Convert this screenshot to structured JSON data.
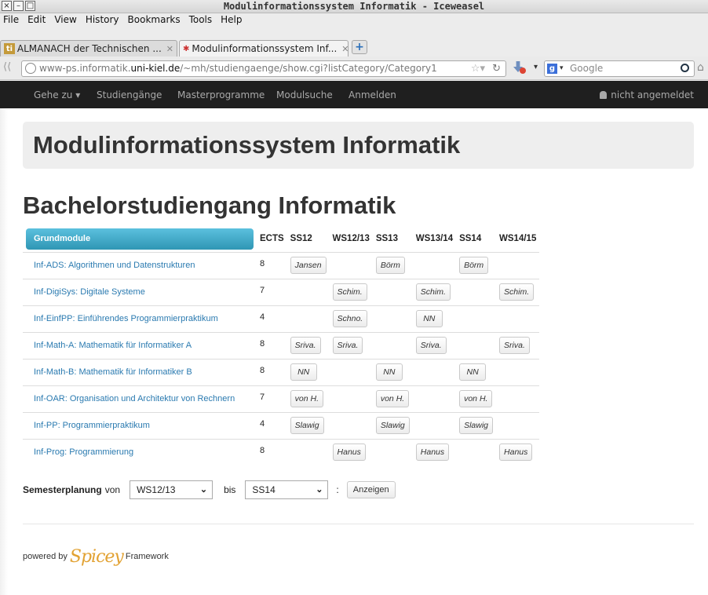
{
  "window": {
    "title": "Modulinformationssystem Informatik - Iceweasel"
  },
  "menubar": [
    "File",
    "Edit",
    "View",
    "History",
    "Bookmarks",
    "Tools",
    "Help"
  ],
  "tabs": [
    {
      "label": "ALMANACH der Technischen ...",
      "active": false
    },
    {
      "label": "Modulinformationssystem Inf...",
      "active": true
    }
  ],
  "url": {
    "prefix": "www-ps.informatik.",
    "host": "uni-kiel.de",
    "path": "/~mh/studiengaenge/show.cgi?listCategory/Category1"
  },
  "search": {
    "placeholder": "Google"
  },
  "sitenav": {
    "items": [
      "Gehe zu ▾",
      "Studiengänge",
      "Masterprogramme",
      "Modulsuche",
      "Anmelden"
    ],
    "user": "nicht angemeldet"
  },
  "page": {
    "title": "Modulinformationssystem Informatik",
    "subtitle": "Bachelorstudiengang Informatik"
  },
  "table": {
    "category": "Grundmodule",
    "headers": [
      "ECTS",
      "SS12",
      "WS12/13",
      "SS13",
      "WS13/14",
      "SS14",
      "WS14/15"
    ],
    "rows": [
      {
        "module": "Inf-ADS: Algorithmen und Datenstrukturen",
        "ects": "8",
        "cells": [
          "Jansen",
          "",
          "Börm",
          "",
          "Börm",
          ""
        ]
      },
      {
        "module": "Inf-DigiSys: Digitale Systeme",
        "ects": "7",
        "cells": [
          "",
          "Schim.",
          "",
          "Schim.",
          "",
          "Schim."
        ]
      },
      {
        "module": "Inf-EinfPP: Einführendes Programmierpraktikum",
        "ects": "4",
        "cells": [
          "",
          "Schno.",
          "",
          "NN",
          "",
          ""
        ]
      },
      {
        "module": "Inf-Math-A: Mathematik für Informatiker A",
        "ects": "8",
        "cells": [
          "Sriva.",
          "Sriva.",
          "",
          "Sriva.",
          "",
          "Sriva."
        ]
      },
      {
        "module": "Inf-Math-B: Mathematik für Informatiker B",
        "ects": "8",
        "cells": [
          "NN",
          "",
          "NN",
          "",
          "NN",
          ""
        ]
      },
      {
        "module": "Inf-OAR: Organisation und Architektur von Rechnern",
        "ects": "7",
        "cells": [
          "von H.",
          "",
          "von H.",
          "",
          "von H.",
          ""
        ]
      },
      {
        "module": "Inf-PP: Programmierpraktikum",
        "ects": "4",
        "cells": [
          "Slawig",
          "",
          "Slawig",
          "",
          "Slawig",
          ""
        ]
      },
      {
        "module": "Inf-Prog: Programmierung",
        "ects": "8",
        "cells": [
          "",
          "Hanus",
          "",
          "Hanus",
          "",
          "Hanus"
        ]
      }
    ]
  },
  "semplan": {
    "label": "Semesterplanung",
    "von": "von",
    "from": "WS12/13",
    "bis": "bis",
    "to": "SS14",
    "colon": ":",
    "button": "Anzeigen"
  },
  "footer": {
    "prefix": "powered by",
    "brand": "Spicey",
    "suffix": "Framework"
  }
}
